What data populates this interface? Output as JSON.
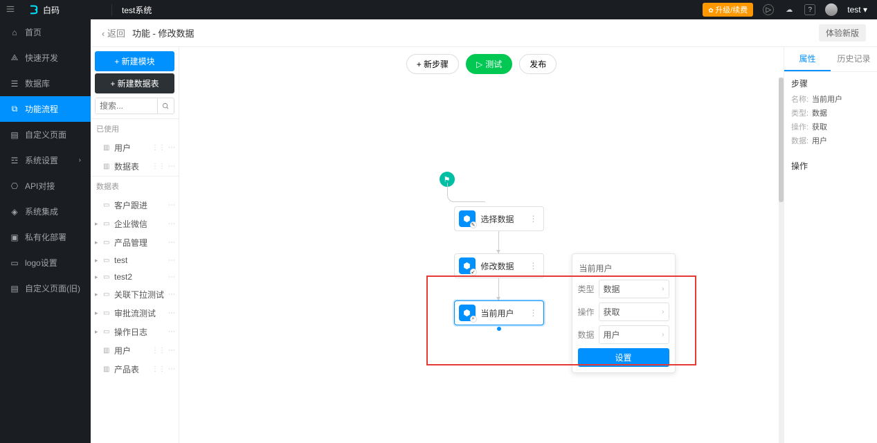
{
  "top": {
    "brand": "白码",
    "system": "test系统",
    "upgrade": "升级/续费",
    "user": "test"
  },
  "sidebar": {
    "items": [
      {
        "label": "首页"
      },
      {
        "label": "快速开发"
      },
      {
        "label": "数据库"
      },
      {
        "label": "功能流程"
      },
      {
        "label": "自定义页面"
      },
      {
        "label": "系统设置"
      },
      {
        "label": "API对接"
      },
      {
        "label": "系统集成"
      },
      {
        "label": "私有化部署"
      },
      {
        "label": "logo设置"
      },
      {
        "label": "自定义页面(旧)"
      }
    ]
  },
  "crumb": {
    "back": "返回",
    "title": "功能 - 修改数据",
    "try": "体验新版"
  },
  "panel": {
    "newModule": "+  新建模块",
    "newTable": "+  新建数据表",
    "searchPlaceholder": "搜索...",
    "usedHdr": "已使用",
    "used": [
      "用户",
      "数据表"
    ],
    "tableHdr": "数据表",
    "folders": [
      "客户跟进",
      "企业微信",
      "产品管理",
      "test",
      "test2",
      "关联下拉测试",
      "审批流测试",
      "操作日志"
    ],
    "leaves": [
      "用户",
      "产品表"
    ]
  },
  "canvas": {
    "newStep": "+ 新步骤",
    "test": "测试",
    "publish": "发布",
    "nodes": {
      "n1": "选择数据",
      "n2": "修改数据",
      "n3": "当前用户"
    }
  },
  "pop": {
    "title": "当前用户",
    "typeK": "类型",
    "typeV": "数据",
    "opK": "操作",
    "opV": "获取",
    "dataK": "数据",
    "dataV": "用户",
    "btn": "设置"
  },
  "right": {
    "tab1": "属性",
    "tab2": "历史记录",
    "stepHdr": "步骤",
    "nameK": "名称:",
    "nameV": "当前用户",
    "typeK": "类型:",
    "typeV": "数据",
    "opK": "操作:",
    "opV": "获取",
    "dataK": "数据:",
    "dataV": "用户",
    "actHdr": "操作"
  }
}
